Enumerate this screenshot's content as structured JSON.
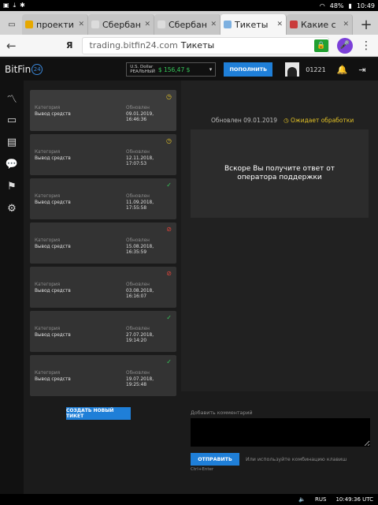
{
  "status_bar": {
    "left_icons": [
      "gallery-icon",
      "download-icon",
      "bluetooth-icon"
    ],
    "battery": "48%",
    "time": "10:49"
  },
  "browser": {
    "tabs": [
      {
        "title": "проекти",
        "color": "#e6a800",
        "active": false
      },
      {
        "title": "Сбербанк",
        "color": "#dcdcdc",
        "active": false
      },
      {
        "title": "Сбербанк",
        "color": "#dcdcdc",
        "active": false
      },
      {
        "title": "Тикеты",
        "color": "#7db0e0",
        "active": true
      },
      {
        "title": "Какие с",
        "color": "#c93c3c",
        "active": false
      }
    ],
    "new_tab": "+",
    "close_glyph": "✕",
    "back": "←",
    "search_engine_letter": "Я",
    "url": "trading.bitfin24.com",
    "page_title": "Тикеты",
    "lock_glyph": "🔒",
    "mic_glyph": "🎤",
    "menu_glyph": "⋮"
  },
  "app": {
    "logo_text": "BitFin",
    "logo_badge": "24",
    "account": {
      "currency": "U.S. Dollar",
      "mode": "РЕАЛЬНЫЙ",
      "balance": "$ 156,47 $",
      "caret": "▾"
    },
    "deposit_label": "ПОПОЛНИТЬ",
    "user_id": "01221",
    "bell_glyph": "🔔",
    "logout_glyph": "⇥"
  },
  "sidebar": {
    "items": [
      {
        "name": "trading-icon",
        "glyph": "〽"
      },
      {
        "name": "wallet-icon",
        "glyph": "▭"
      },
      {
        "name": "tickets-icon",
        "glyph": "▤"
      },
      {
        "name": "chat-icon",
        "glyph": "💬"
      },
      {
        "name": "flag-icon",
        "glyph": "⚑"
      },
      {
        "name": "settings-icon",
        "glyph": "⚙"
      }
    ]
  },
  "tickets": {
    "category_label": "Категория",
    "updated_label": "Обновлен",
    "items": [
      {
        "category": "Вывод средств",
        "updated_line1": "09.01.2019,",
        "updated_line2": "16:46:36",
        "status": "pending",
        "glyph": "◷",
        "color": "#e3c226",
        "selected": true
      },
      {
        "category": "Вывод средств",
        "updated_line1": "12.11.2018,",
        "updated_line2": "17:07:53",
        "status": "pending",
        "glyph": "◷",
        "color": "#e3c226",
        "selected": false
      },
      {
        "category": "Вывод средств",
        "updated_line1": "11.09.2018,",
        "updated_line2": "17:55:58",
        "status": "done",
        "glyph": "✓",
        "color": "#35c759",
        "selected": false
      },
      {
        "category": "Вывод средств",
        "updated_line1": "15.08.2018,",
        "updated_line2": "16:35:59",
        "status": "rejected",
        "glyph": "⊘",
        "color": "#e0443a",
        "selected": false
      },
      {
        "category": "Вывод средств",
        "updated_line1": "03.08.2018,",
        "updated_line2": "16:16:07",
        "status": "rejected",
        "glyph": "⊘",
        "color": "#e0443a",
        "selected": false
      },
      {
        "category": "Вывод средств",
        "updated_line1": "27.07.2018,",
        "updated_line2": "19:14:20",
        "status": "done",
        "glyph": "✓",
        "color": "#35c759",
        "selected": false
      },
      {
        "category": "Вывод средств",
        "updated_line1": "19.07.2018,",
        "updated_line2": "19:25:48",
        "status": "done",
        "glyph": "✓",
        "color": "#35c759",
        "selected": false
      }
    ],
    "new_ticket_label": "СОЗДАТЬ НОВЫЙ ТИКЕТ"
  },
  "detail": {
    "updated": "Обновлен 09.01.2019",
    "status_glyph": "◷",
    "status": "Ожидает обработки",
    "message": "Вскоре Вы получите ответ от оператора поддержки"
  },
  "composer": {
    "label": "Добавить комментарий",
    "value": "",
    "send_label": "ОТПРАВИТЬ",
    "hint": "Или используйте комбинацию клавиш",
    "shortcut": "Ctrl+Enter"
  },
  "bottom_bar": {
    "volume_glyph": "🔈",
    "language": "RUS",
    "time": "10:49:36 UTC"
  },
  "colors": {
    "accent": "#1f7fd8",
    "pending": "#e3c226",
    "done": "#35c759",
    "rejected": "#e0443a",
    "balance": "#35c759"
  }
}
